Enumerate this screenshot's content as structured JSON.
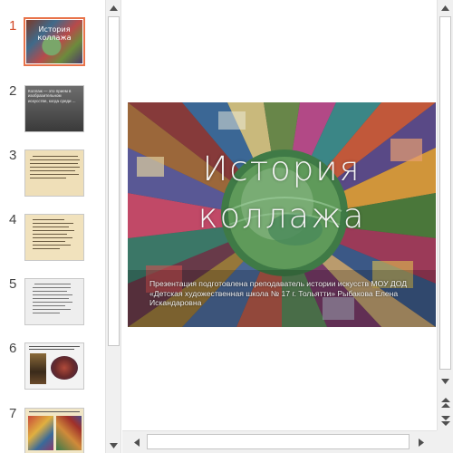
{
  "thumbnails": [
    {
      "number": "1",
      "active": true,
      "type": "title",
      "text": "История коллажа"
    },
    {
      "number": "2",
      "active": false,
      "type": "dark",
      "text": "Коллаж — это прием в изобразительном искусстве, когда среди ..."
    },
    {
      "number": "3",
      "active": false,
      "type": "text"
    },
    {
      "number": "4",
      "active": false,
      "type": "text"
    },
    {
      "number": "5",
      "active": false,
      "type": "text"
    },
    {
      "number": "6",
      "active": false,
      "type": "images"
    },
    {
      "number": "7",
      "active": false,
      "type": "images"
    }
  ],
  "slide": {
    "title_line1": "История",
    "title_line2": "коллажа",
    "subtitle": "Презентация подготовлена преподаватель истории искусств МОУ ДОД «Детская художественная школа № 17 г. Тольятти» Рыбакова Елена Искандаровна"
  },
  "icons": {
    "scroll_up": "scroll-up-arrow-icon",
    "scroll_down": "scroll-down-arrow-icon",
    "scroll_left": "scroll-left-arrow-icon",
    "scroll_right": "scroll-right-arrow-icon",
    "prev_slide": "previous-slide-icon",
    "next_slide": "next-slide-icon"
  },
  "colors": {
    "active_number": "#d24726",
    "active_border": "#e8734a",
    "scrollbar_bg": "#f0f0f0"
  }
}
